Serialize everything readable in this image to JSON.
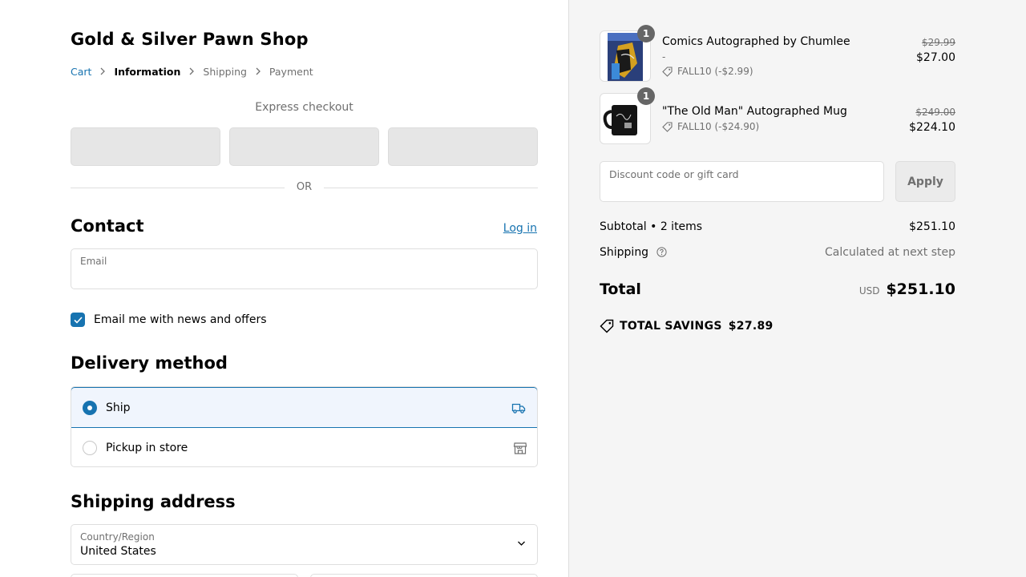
{
  "shop": {
    "name": "Gold & Silver Pawn Shop"
  },
  "breadcrumb": {
    "cart": "Cart",
    "information": "Information",
    "shipping": "Shipping",
    "payment": "Payment"
  },
  "express": {
    "label": "Express checkout",
    "or": "OR"
  },
  "contact": {
    "heading": "Contact",
    "login": "Log in",
    "email_label": "Email",
    "email_value": "",
    "newsletter_label": "Email me with news and offers",
    "newsletter_checked": true
  },
  "delivery": {
    "heading": "Delivery method",
    "options": [
      {
        "label": "Ship",
        "selected": true,
        "icon": "truck-icon"
      },
      {
        "label": "Pickup in store",
        "selected": false,
        "icon": "store-icon"
      }
    ]
  },
  "shipping_address": {
    "heading": "Shipping address",
    "country_label": "Country/Region",
    "country_value": "United States"
  },
  "cart": {
    "items": [
      {
        "title": "Comics Autographed by Chumlee",
        "variant": "-",
        "discount": "FALL10 (-$2.99)",
        "price_original": "$29.99",
        "price": "$27.00",
        "qty": "1"
      },
      {
        "title": "\"The Old Man\" Autographed Mug",
        "variant": "",
        "discount": "FALL10 (-$24.90)",
        "price_original": "$249.00",
        "price": "$224.10",
        "qty": "1"
      }
    ],
    "discount_placeholder": "Discount code or gift card",
    "apply_label": "Apply",
    "subtotal_label": "Subtotal • 2 items",
    "subtotal_value": "$251.10",
    "shipping_label": "Shipping",
    "shipping_value": "Calculated at next step",
    "total_label": "Total",
    "currency": "USD",
    "total_value": "$251.10",
    "savings_label": "TOTAL SAVINGS",
    "savings_value": "$27.89"
  },
  "colors": {
    "accent": "#1773b0",
    "sidebar_bg": "#f5f5f5",
    "selected_bg": "#f0f5fd"
  }
}
